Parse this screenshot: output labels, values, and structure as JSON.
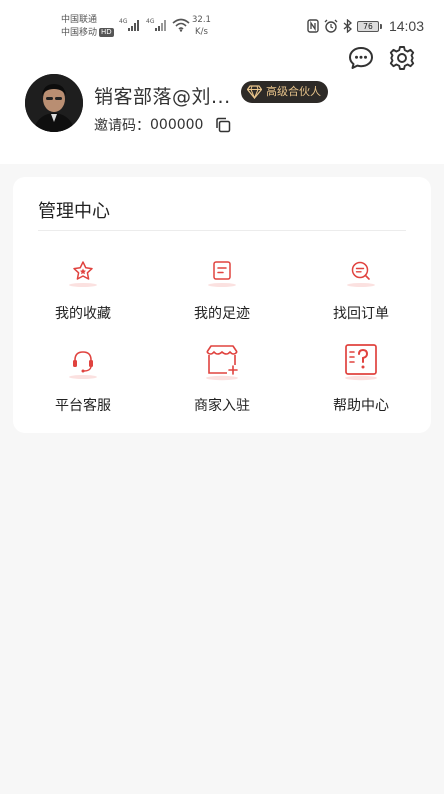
{
  "status_bar": {
    "carrier1": "中国联通",
    "carrier2": "中国移动",
    "hd": "HD",
    "net1": "4G",
    "net2": "4G",
    "speed_value": "32.1",
    "speed_unit": "K/s",
    "battery": "76",
    "time": "14:03"
  },
  "header": {
    "message_icon": "chat-bubble",
    "settings_icon": "gear"
  },
  "profile": {
    "nickname": "销客部落@刘...",
    "badge": "高级合伙人",
    "invite_label": "邀请码：",
    "invite_code": "000000"
  },
  "management": {
    "title": "管理中心",
    "items": [
      {
        "label": "我的收藏",
        "icon": "star-icon"
      },
      {
        "label": "我的足迹",
        "icon": "footprint-icon"
      },
      {
        "label": "找回订单",
        "icon": "search-order-icon"
      },
      {
        "label": "平台客服",
        "icon": "headset-icon"
      },
      {
        "label": "商家入驻",
        "icon": "store-icon"
      },
      {
        "label": "帮助中心",
        "icon": "help-icon"
      }
    ]
  },
  "colors": {
    "accent": "#e0433f",
    "badge_bg": "#2d2a27",
    "badge_text": "#e8c48b"
  }
}
